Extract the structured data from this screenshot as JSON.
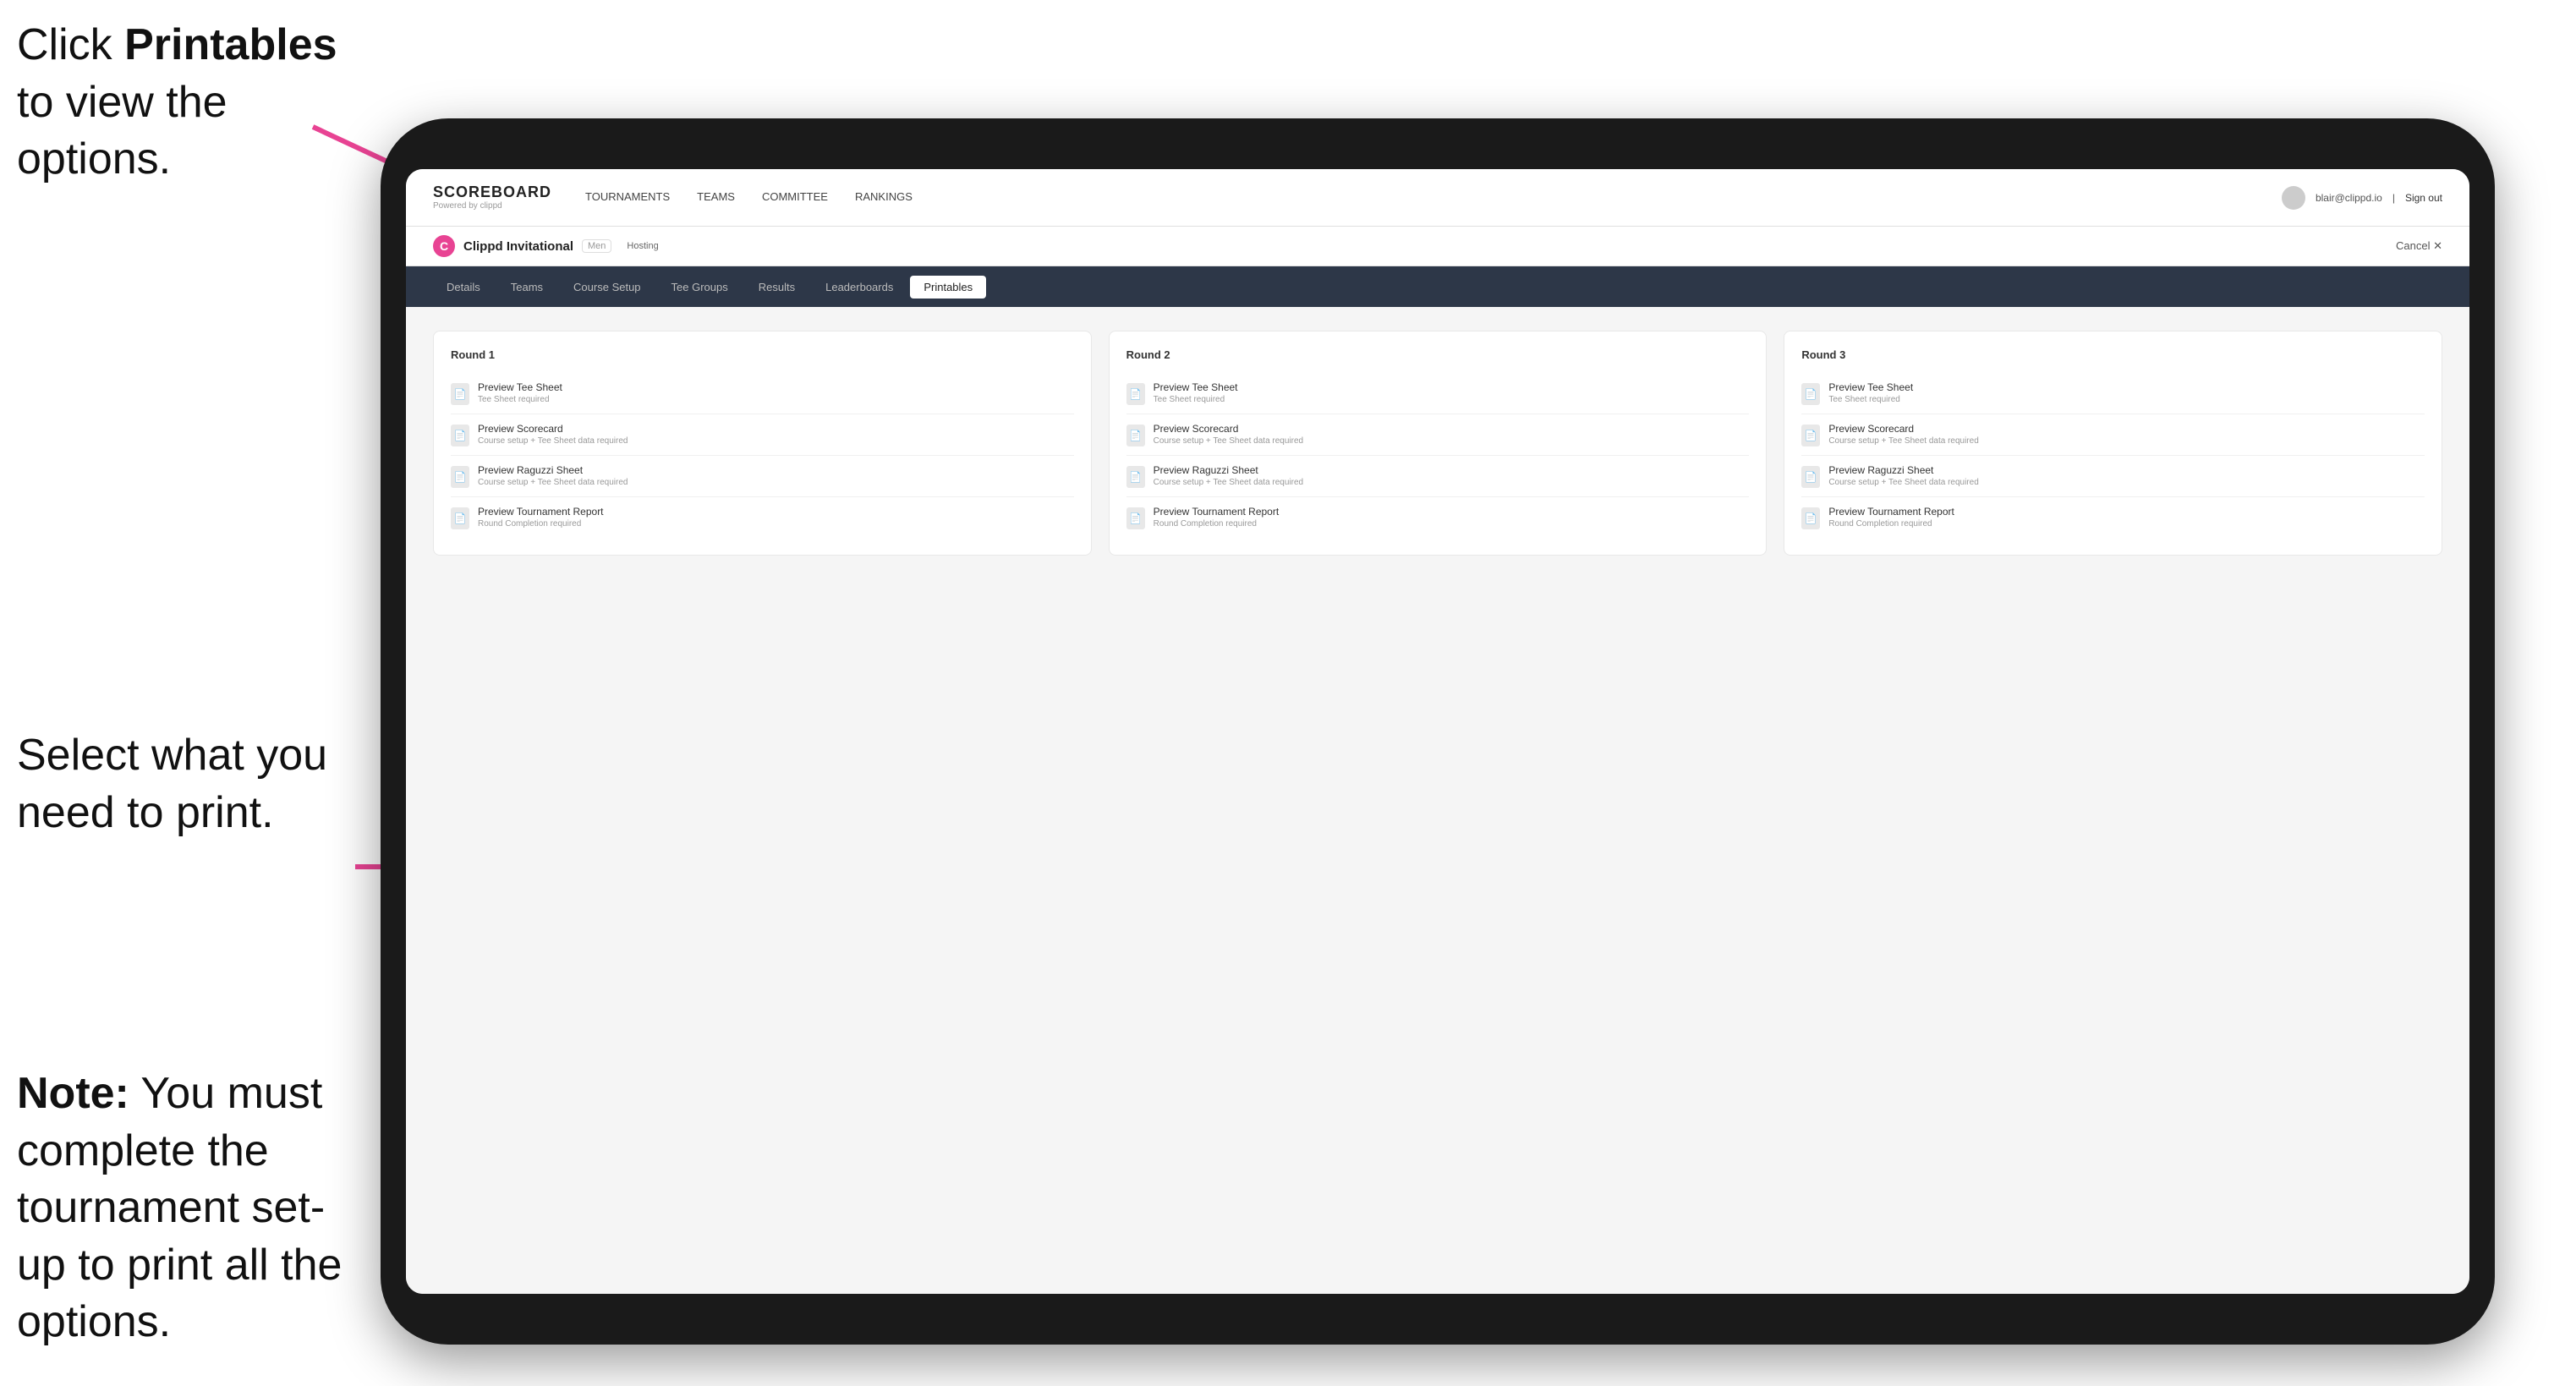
{
  "annotations": {
    "top": {
      "text_before": "Click ",
      "text_bold": "Printables",
      "text_after": " to view the options."
    },
    "middle": {
      "line1": "Select what you",
      "line2": "need to print."
    },
    "bottom": {
      "line1": "Note:",
      "line1_rest": " You must complete the tournament set-up to print all the options."
    }
  },
  "top_nav": {
    "brand_title": "SCOREBOARD",
    "brand_sub": "Powered by clippd",
    "links": [
      {
        "label": "TOURNAMENTS",
        "active": false
      },
      {
        "label": "TEAMS",
        "active": false
      },
      {
        "label": "COMMITTEE",
        "active": false
      },
      {
        "label": "RANKINGS",
        "active": false
      }
    ],
    "user_email": "blair@clippd.io",
    "sign_out": "Sign out"
  },
  "tournament_header": {
    "logo_letter": "C",
    "name": "Clippd Invitational",
    "badge": "Men",
    "status": "Hosting",
    "cancel": "Cancel"
  },
  "sub_nav": {
    "tabs": [
      {
        "label": "Details",
        "active": false
      },
      {
        "label": "Teams",
        "active": false
      },
      {
        "label": "Course Setup",
        "active": false
      },
      {
        "label": "Tee Groups",
        "active": false
      },
      {
        "label": "Results",
        "active": false
      },
      {
        "label": "Leaderboards",
        "active": false
      },
      {
        "label": "Printables",
        "active": true
      }
    ]
  },
  "rounds": [
    {
      "title": "Round 1",
      "items": [
        {
          "title": "Preview Tee Sheet",
          "subtitle": "Tee Sheet required"
        },
        {
          "title": "Preview Scorecard",
          "subtitle": "Course setup + Tee Sheet data required"
        },
        {
          "title": "Preview Raguzzi Sheet",
          "subtitle": "Course setup + Tee Sheet data required"
        },
        {
          "title": "Preview Tournament Report",
          "subtitle": "Round Completion required"
        }
      ]
    },
    {
      "title": "Round 2",
      "items": [
        {
          "title": "Preview Tee Sheet",
          "subtitle": "Tee Sheet required"
        },
        {
          "title": "Preview Scorecard",
          "subtitle": "Course setup + Tee Sheet data required"
        },
        {
          "title": "Preview Raguzzi Sheet",
          "subtitle": "Course setup + Tee Sheet data required"
        },
        {
          "title": "Preview Tournament Report",
          "subtitle": "Round Completion required"
        }
      ]
    },
    {
      "title": "Round 3",
      "items": [
        {
          "title": "Preview Tee Sheet",
          "subtitle": "Tee Sheet required"
        },
        {
          "title": "Preview Scorecard",
          "subtitle": "Course setup + Tee Sheet data required"
        },
        {
          "title": "Preview Raguzzi Sheet",
          "subtitle": "Course setup + Tee Sheet data required"
        },
        {
          "title": "Preview Tournament Report",
          "subtitle": "Round Completion required"
        }
      ]
    }
  ]
}
